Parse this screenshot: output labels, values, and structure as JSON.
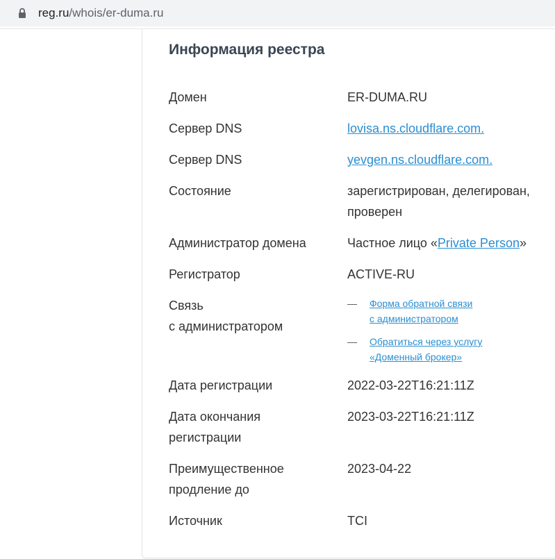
{
  "browser": {
    "url_host": "reg.ru",
    "url_path": "/whois/er-duma.ru"
  },
  "registry": {
    "title": "Информация реестра",
    "domain": {
      "label": "Домен",
      "value": "ER-DUMA.RU"
    },
    "dns1": {
      "label": "Сервер DNS",
      "value": "lovisa.ns.cloudflare.com."
    },
    "dns2": {
      "label": "Сервер DNS",
      "value": "yevgen.ns.cloudflare.com."
    },
    "state": {
      "label": "Состояние",
      "value_line1": "зарегистрирован, делегирован,",
      "value_line2": "проверен"
    },
    "admin": {
      "label": "Администратор домена",
      "prefix": "Частное лицо «",
      "link": "Private Person",
      "suffix": "»"
    },
    "registrar": {
      "label": "Регистратор",
      "value": "ACTIVE-RU"
    },
    "contact": {
      "label_line1": "Связь",
      "label_line2": "с администратором",
      "dash": "—",
      "link1_line1": "Форма обратной связи",
      "link1_line2": "с администратором",
      "link2_line1": "Обратиться через услугу",
      "link2_line2": "«Доменный брокер»"
    },
    "created": {
      "label": "Дата регистрации",
      "value": "2022-03-22T16:21:11Z"
    },
    "expires": {
      "label_line1": "Дата окончания",
      "label_line2": "регистрации",
      "value": "2023-03-22T16:21:11Z"
    },
    "renewal": {
      "label_line1": "Преимущественное",
      "label_line2": "продление до",
      "value": "2023-04-22"
    },
    "source": {
      "label": "Источник",
      "value": "TCI"
    }
  },
  "colors": {
    "link": "#2a8ed1",
    "title": "#3a4653",
    "text": "#333333"
  }
}
